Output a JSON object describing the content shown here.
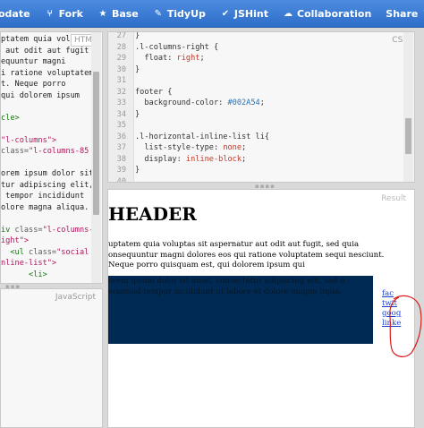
{
  "toolbar": {
    "items": [
      {
        "label": "odate",
        "icon": "none"
      },
      {
        "label": "Fork",
        "icon": "fork-icon"
      },
      {
        "label": "Base",
        "icon": "star-icon"
      },
      {
        "label": "TidyUp",
        "icon": "pencil-icon"
      },
      {
        "label": "JSHint",
        "icon": "checkmark-icon"
      },
      {
        "label": "Collaboration",
        "icon": "cloud-icon"
      },
      {
        "label": "Share",
        "icon": "caret-down-icon"
      }
    ]
  },
  "html_panel": {
    "label": "HTML",
    "lines": [
      [
        {
          "t": "ptatem quia voluptas",
          "c": "c-txt"
        }
      ],
      [
        {
          "t": " aut odit aut fugit",
          "c": "c-txt"
        }
      ],
      [
        {
          "t": "equuntur magni",
          "c": "c-txt"
        }
      ],
      [
        {
          "t": "i ratione voluptatem",
          "c": "c-txt"
        }
      ],
      [
        {
          "t": "t. Neque porro",
          "c": "c-txt"
        }
      ],
      [
        {
          "t": "qui dolorem ipsum",
          "c": "c-txt"
        }
      ],
      [
        {
          "t": "",
          "c": "c-txt"
        }
      ],
      [
        {
          "t": "cle>",
          "c": "c-tag"
        }
      ],
      [
        {
          "t": "",
          "c": "c-txt"
        }
      ],
      [
        {
          "t": "\"l-columns\">",
          "c": "c-str"
        }
      ],
      [
        {
          "t": "class=",
          "c": "c-attr"
        },
        {
          "t": "\"l-columns-85",
          "c": "c-str"
        }
      ],
      [
        {
          "t": "",
          "c": "c-txt"
        }
      ],
      [
        {
          "t": "orem ipsum dolor sit",
          "c": "c-txt"
        }
      ],
      [
        {
          "t": "tur adipiscing elit,",
          "c": "c-txt"
        }
      ],
      [
        {
          "t": " tempor incididunt",
          "c": "c-txt"
        }
      ],
      [
        {
          "t": "olore magna aliqua.",
          "c": "c-txt"
        }
      ],
      [
        {
          "t": "",
          "c": "c-txt"
        }
      ],
      [
        {
          "t": "iv ",
          "c": "c-tag"
        },
        {
          "t": "class=",
          "c": "c-attr"
        },
        {
          "t": "\"l-columns-",
          "c": "c-str"
        }
      ],
      [
        {
          "t": "ight\">",
          "c": "c-str"
        }
      ],
      [
        {
          "t": "  <ul ",
          "c": "c-tag"
        },
        {
          "t": "class=",
          "c": "c-attr"
        },
        {
          "t": "\"social",
          "c": "c-str"
        }
      ],
      [
        {
          "t": "nline-list\">",
          "c": "c-str"
        }
      ],
      [
        {
          "t": "      <li>",
          "c": "c-tag"
        }
      ]
    ]
  },
  "css_panel": {
    "label": "CSS",
    "line_numbers": [
      "27",
      "28",
      "29",
      "30",
      "31",
      "32",
      "33",
      "34",
      "35",
      "36",
      "37",
      "38",
      "39",
      "40"
    ],
    "lines": [
      [
        {
          "t": "}",
          "c": "c-sel"
        }
      ],
      [
        {
          "t": ".l-columns-right {",
          "c": "c-sel"
        }
      ],
      [
        {
          "t": "  float: ",
          "c": "c-prop"
        },
        {
          "t": "right",
          "c": "c-val"
        },
        {
          "t": ";",
          "c": "c-prop"
        }
      ],
      [
        {
          "t": "}",
          "c": "c-sel"
        }
      ],
      [
        {
          "t": "",
          "c": "c-sel"
        }
      ],
      [
        {
          "t": "footer {",
          "c": "c-sel"
        }
      ],
      [
        {
          "t": "  background-color: ",
          "c": "c-prop"
        },
        {
          "t": "#002A54",
          "c": "c-num"
        },
        {
          "t": ";",
          "c": "c-prop"
        }
      ],
      [
        {
          "t": "}",
          "c": "c-sel"
        }
      ],
      [
        {
          "t": "",
          "c": "c-sel"
        }
      ],
      [
        {
          "t": ".l-horizontal-inline-list li{",
          "c": "c-sel"
        }
      ],
      [
        {
          "t": "  list-style-type: ",
          "c": "c-prop"
        },
        {
          "t": "none",
          "c": "c-val"
        },
        {
          "t": ";",
          "c": "c-prop"
        }
      ],
      [
        {
          "t": "  display: ",
          "c": "c-prop"
        },
        {
          "t": "inline-block",
          "c": "c-val"
        },
        {
          "t": ";",
          "c": "c-prop"
        }
      ],
      [
        {
          "t": "}",
          "c": "c-sel"
        }
      ],
      [
        {
          "t": "",
          "c": "c-sel"
        }
      ]
    ]
  },
  "js_panel": {
    "label": "JavaScript"
  },
  "result_panel": {
    "label": "Result",
    "heading": "HEADER",
    "paragraph": "uptatem quia voluptas sit aspernatur aut odit aut fugit, sed quia onsequuntur magni dolores eos qui ratione voluptatem sequi nesciunt. Neque porro quisquam est, qui dolorem ipsum qui",
    "footer_text": "orem ipsum dolor sit amet, consectetur adipiscing elit, sed o eiusmod tempor incididunt ut labore et dolore magna liqua.",
    "links": [
      "fac",
      "twit",
      "goog",
      "linke"
    ],
    "footer_color": "#002a54",
    "annotation_color": "#d81c1c"
  }
}
